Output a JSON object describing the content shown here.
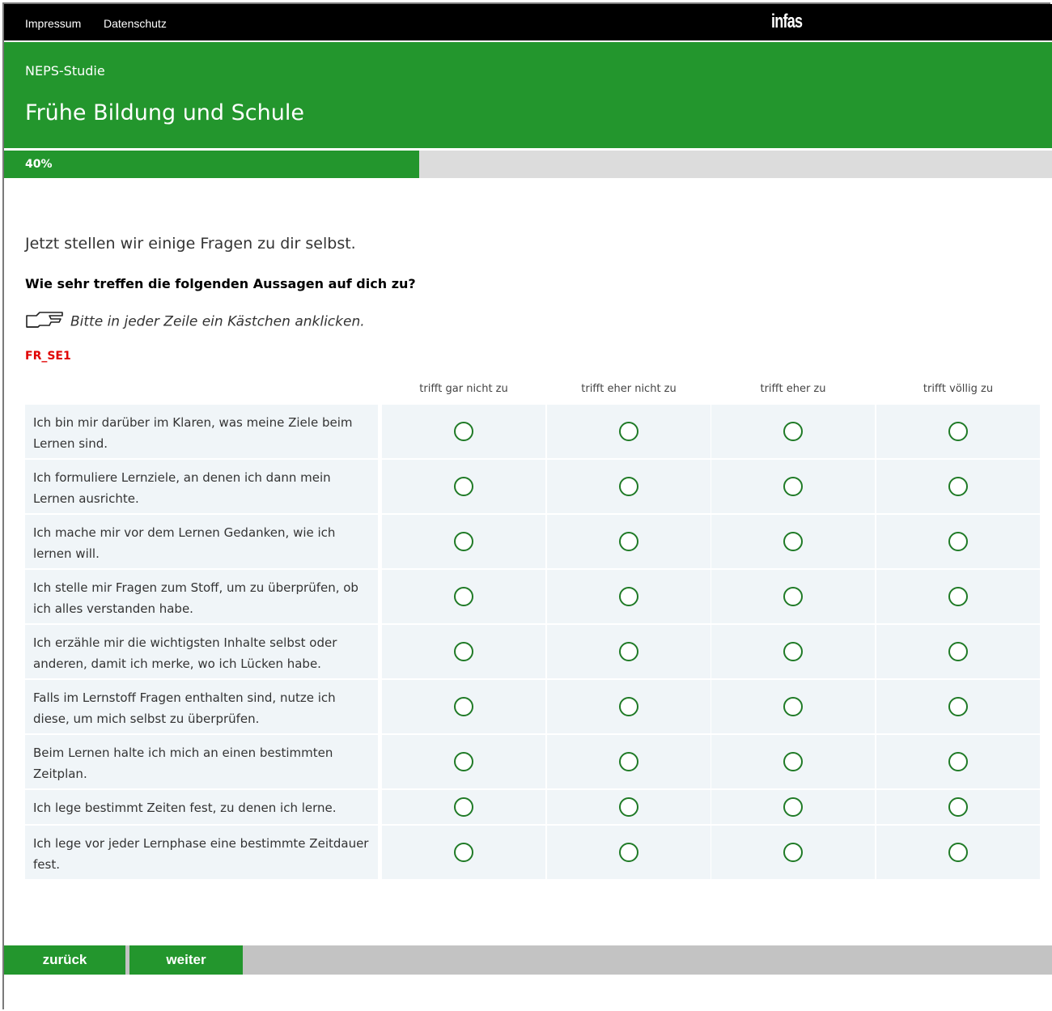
{
  "topbar": {
    "links": [
      "Impressum",
      "Datenschutz"
    ],
    "logo": "infas"
  },
  "header": {
    "study": "NEPS-Studie",
    "title": "Frühe Bildung und Schule"
  },
  "progress": {
    "percent": 40,
    "label": "40%"
  },
  "content": {
    "intro": "Jetzt stellen wir einige Fragen zu dir selbst.",
    "question": "Wie sehr treffen die folgenden Aussagen auf dich zu?",
    "hint_icon": "pointing-hand-icon",
    "hint": "Bitte in jeder Zeile ein Kästchen anklicken.",
    "question_id": "FR_SE1"
  },
  "grid": {
    "columns": [
      "trifft gar nicht zu",
      "trifft eher nicht zu",
      "trifft eher zu",
      "trifft völlig zu"
    ],
    "items": [
      "Ich bin mir darüber im Klaren, was meine Ziele beim Lernen sind.",
      "Ich formuliere Lernziele, an denen ich dann mein Lernen ausrichte.",
      "Ich mache mir vor dem Lernen Gedanken, wie ich lernen will.",
      "Ich stelle mir Fragen zum Stoff, um zu überprüfen, ob ich alles verstanden habe.",
      "Ich erzähle mir die wichtigsten Inhalte selbst oder anderen, damit ich merke, wo ich Lücken habe.",
      "Falls im Lernstoff Fragen enthalten sind, nutze ich diese, um mich selbst zu überprüfen.",
      "Beim Lernen halte ich mich an einen bestimmten Zeitplan.",
      "Ich lege bestimmt Zeiten fest, zu denen ich lerne.",
      "Ich lege vor jeder Lernphase eine bestimmte Zeitdauer fest."
    ]
  },
  "footer": {
    "back_label": "zurück",
    "next_label": "weiter"
  },
  "colors": {
    "brand_green": "#23962d",
    "cell_bg": "#f0f5f8",
    "qid_red": "#e00000"
  }
}
